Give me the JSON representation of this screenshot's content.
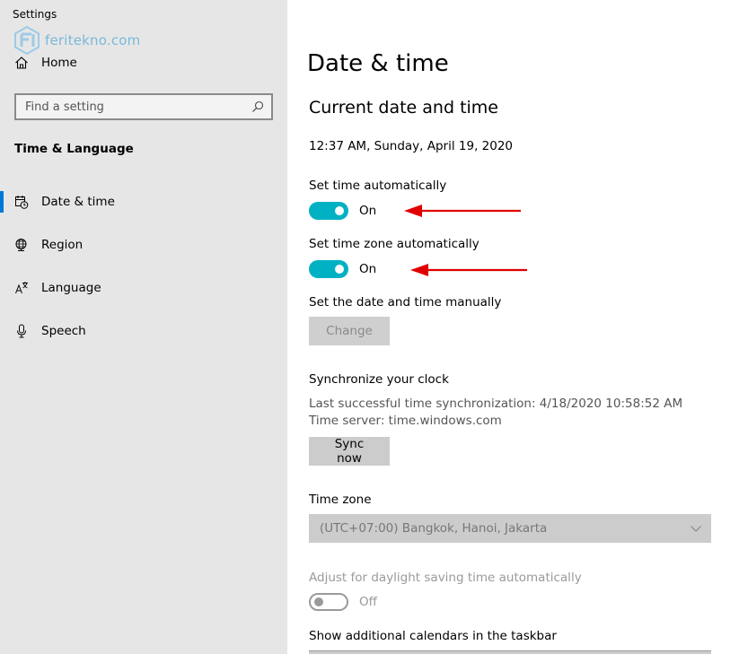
{
  "window": {
    "title": "Settings"
  },
  "watermark": {
    "text": "feritekno.com"
  },
  "sidebar": {
    "home_label": "Home",
    "search": {
      "placeholder": "Find a setting"
    },
    "section_heading": "Time & Language",
    "items": [
      {
        "label": "Date & time",
        "icon": "clock-calendar-icon",
        "selected": true
      },
      {
        "label": "Region",
        "icon": "globe-icon",
        "selected": false
      },
      {
        "label": "Language",
        "icon": "language-icon",
        "selected": false
      },
      {
        "label": "Speech",
        "icon": "microphone-icon",
        "selected": false
      }
    ]
  },
  "main": {
    "title": "Date & time",
    "subtitle": "Current date and time",
    "current_datetime": "12:37 AM, Sunday, April 19, 2020",
    "set_time_auto": {
      "label": "Set time automatically",
      "state": "On"
    },
    "set_timezone_auto": {
      "label": "Set time zone automatically",
      "state": "On"
    },
    "manual": {
      "label": "Set the date and time manually",
      "button": "Change"
    },
    "sync": {
      "label": "Synchronize your clock",
      "last_sync": "Last successful time synchronization: 4/18/2020 10:58:52 AM",
      "server": "Time server: time.windows.com",
      "button": "Sync now"
    },
    "timezone": {
      "label": "Time zone",
      "value": "(UTC+07:00) Bangkok, Hanoi, Jakarta"
    },
    "dst": {
      "label": "Adjust for daylight saving time automatically",
      "state": "Off"
    },
    "calendars": {
      "label": "Show additional calendars in the taskbar"
    }
  },
  "colors": {
    "accent": "#0078d7",
    "toggle_on": "#00b1c4",
    "annotation_arrow": "#e00000",
    "sidebar_bg": "#e6e6e6"
  }
}
